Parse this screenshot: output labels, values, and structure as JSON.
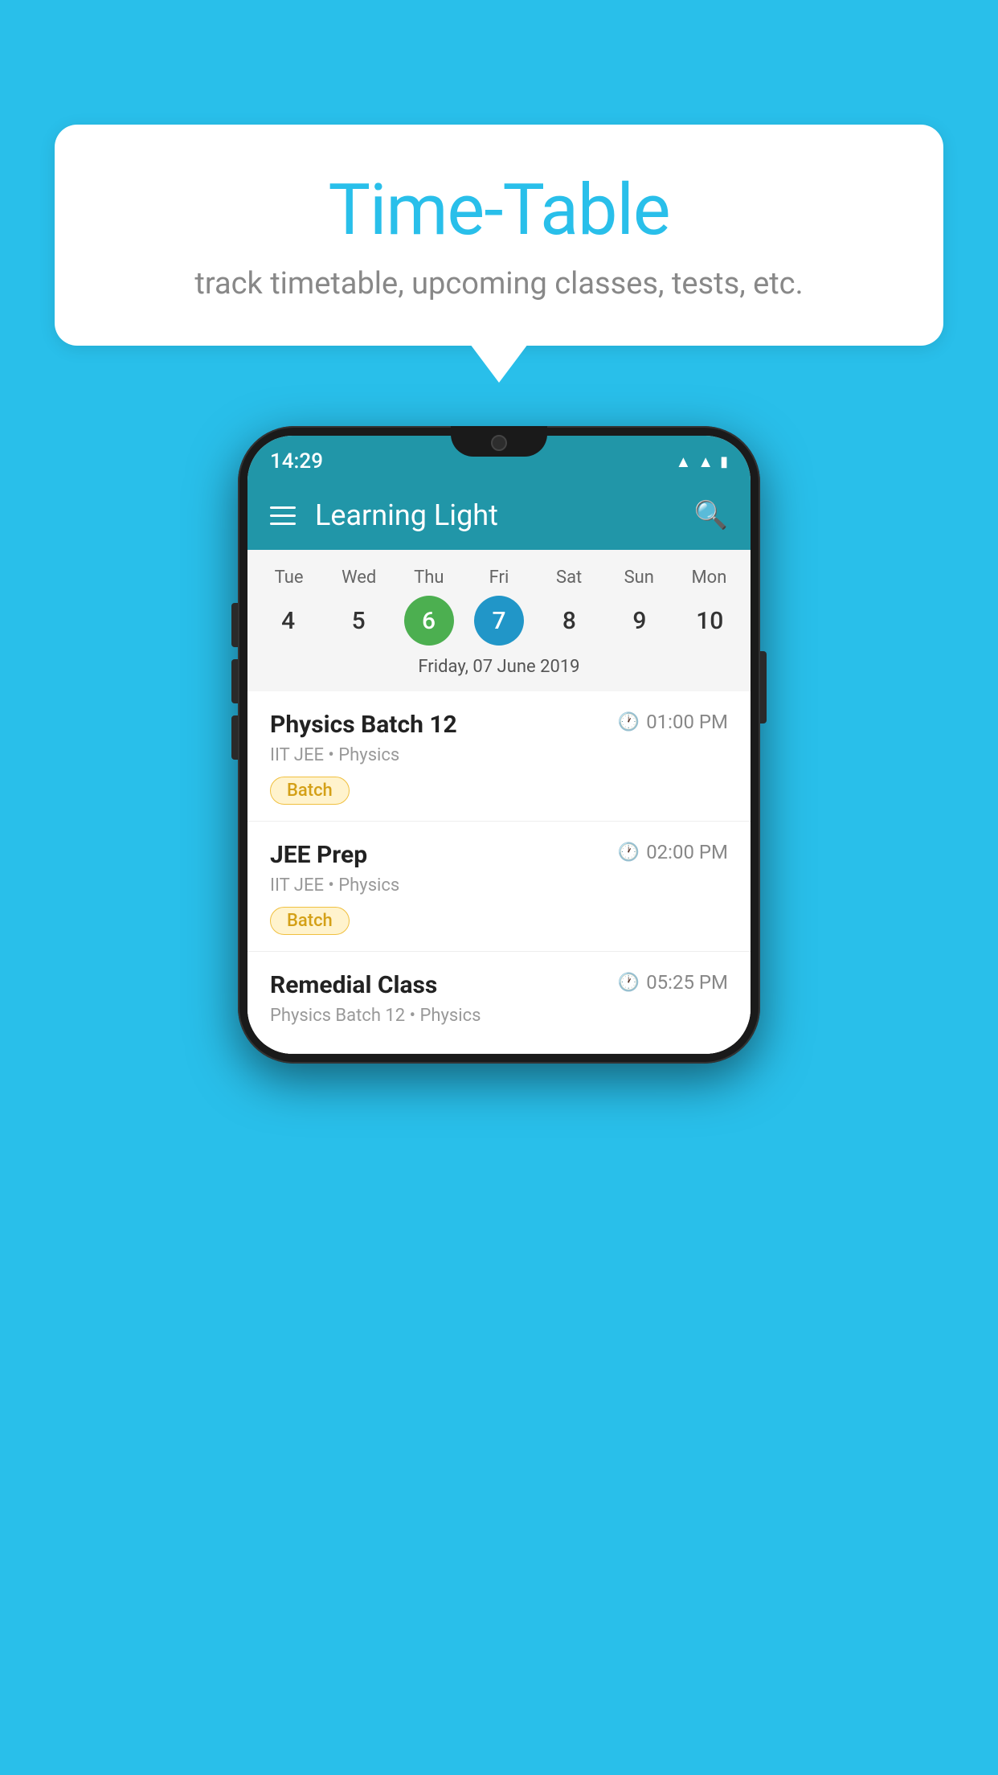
{
  "background_color": "#29BFEA",
  "bubble": {
    "title": "Time-Table",
    "subtitle": "track timetable, upcoming classes, tests, etc."
  },
  "phone": {
    "status_bar": {
      "time": "14:29"
    },
    "header": {
      "title": "Learning Light",
      "hamburger_label": "menu",
      "search_label": "search"
    },
    "calendar": {
      "days": [
        "Tue",
        "Wed",
        "Thu",
        "Fri",
        "Sat",
        "Sun",
        "Mon"
      ],
      "dates": [
        "4",
        "5",
        "6",
        "7",
        "8",
        "9",
        "10"
      ],
      "today_index": 2,
      "selected_index": 3,
      "selected_date_label": "Friday, 07 June 2019"
    },
    "schedule": [
      {
        "title": "Physics Batch 12",
        "time": "01:00 PM",
        "meta": "IIT JEE • Physics",
        "badge": "Batch"
      },
      {
        "title": "JEE Prep",
        "time": "02:00 PM",
        "meta": "IIT JEE • Physics",
        "badge": "Batch"
      },
      {
        "title": "Remedial Class",
        "time": "05:25 PM",
        "meta": "Physics Batch 12 • Physics",
        "badge": ""
      }
    ]
  }
}
